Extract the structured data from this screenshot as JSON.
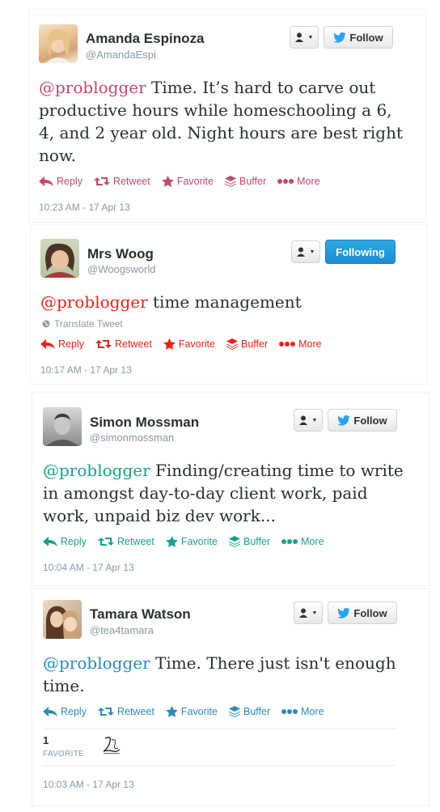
{
  "colors": {
    "maroon": "#c04a6a",
    "red": "#e8221a",
    "teal": "#1aa090",
    "blue": "#2c8ab9",
    "twitter_blue": "#2aa3ef"
  },
  "tweets": [
    {
      "name": "Amanda Espinoza",
      "handle": "@AmandaEspi",
      "follow_label": "Follow",
      "mention": "@problogger",
      "text_lines": [
        "Time. It’s hard to carve out",
        "productive hours while homeschooling a 6,",
        "4, and 2 year old. Night hours are best right",
        "now."
      ],
      "actions": {
        "reply": "Reply",
        "retweet": "Retweet",
        "favorite": "Favorite",
        "buffer": "Buffer",
        "more": "More"
      },
      "timestamp": "10:23 AM - 17 Apr 13",
      "accent": "maroon"
    },
    {
      "name": "Mrs Woog",
      "handle": "@Woogsworld",
      "follow_label": "Following",
      "mention": "@problogger",
      "text_lines": [
        "time management"
      ],
      "translate": "Translate Tweet",
      "actions": {
        "reply": "Reply",
        "retweet": "Retweet",
        "favorite": "Favorite",
        "buffer": "Buffer",
        "more": "More"
      },
      "timestamp": "10:17 AM - 17 Apr 13",
      "accent": "red"
    },
    {
      "name": "Simon Mossman",
      "handle": "@simonmossman",
      "follow_label": "Follow",
      "mention": "@problogger",
      "text_lines": [
        "Finding/creating time to write",
        "in amongst day-to-day client work, paid",
        "work, unpaid biz dev work..."
      ],
      "actions": {
        "reply": "Reply",
        "retweet": "Retweet",
        "favorite": "Favorite",
        "buffer": "Buffer",
        "more": "More"
      },
      "timestamp": "10:04 AM - 17 Apr 13",
      "accent": "teal"
    },
    {
      "name": "Tamara Watson",
      "handle": "@tea4tamara",
      "follow_label": "Follow",
      "mention": "@problogger",
      "text_lines": [
        "Time. There just isn't enough",
        "time."
      ],
      "actions": {
        "reply": "Reply",
        "retweet": "Retweet",
        "favorite": "Favorite",
        "buffer": "Buffer",
        "more": "More"
      },
      "favorites_count": "1",
      "favorites_label": "FAVORITE",
      "timestamp": "10:03 AM - 17 Apr 13",
      "accent": "blue"
    }
  ]
}
